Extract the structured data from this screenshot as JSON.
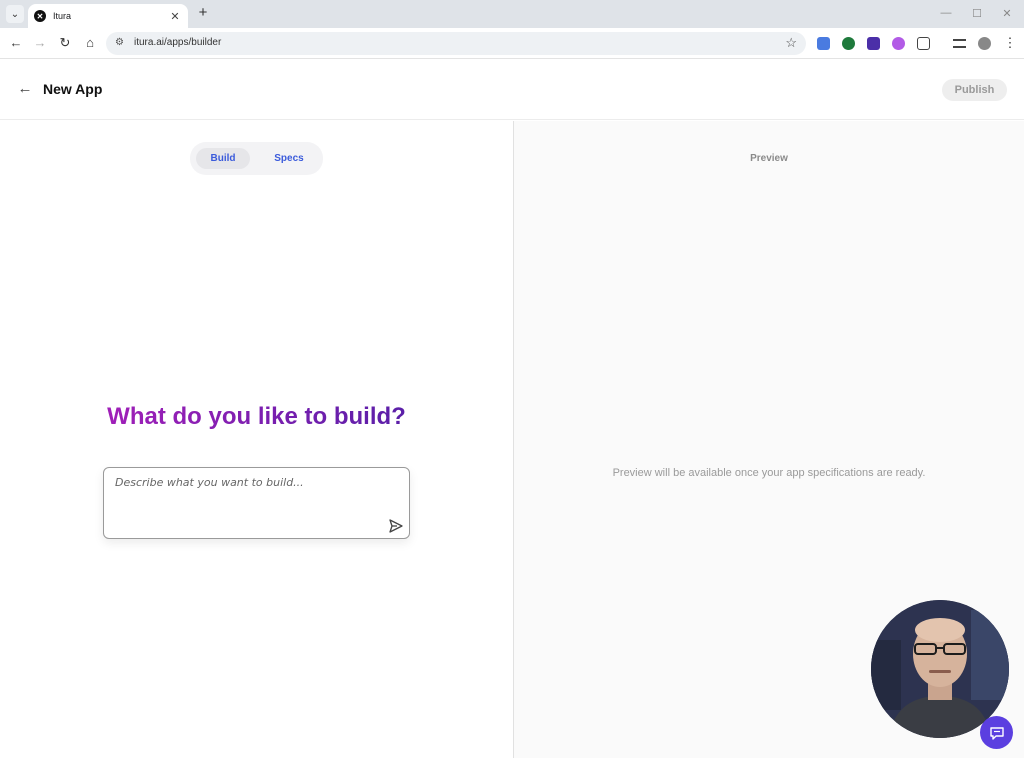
{
  "browser": {
    "tab": {
      "title": "Itura",
      "favicon": "itura-logo-icon"
    },
    "url": "itura.ai/apps/builder"
  },
  "header": {
    "title": "New App",
    "publish_label": "Publish"
  },
  "builder": {
    "tabs": [
      {
        "label": "Build",
        "active": true
      },
      {
        "label": "Specs",
        "active": false
      }
    ],
    "headline": "What do you like to build?",
    "prompt": {
      "placeholder": "Describe what you want to build...",
      "value": ""
    }
  },
  "preview": {
    "label": "Preview",
    "message": "Preview will be available once your app specifications are ready."
  },
  "colors": {
    "accent": "#3b5bdb",
    "headline_gradient": [
      "#a01fb8",
      "#5a1fa8"
    ],
    "chat_button": "#5b3fe0"
  }
}
